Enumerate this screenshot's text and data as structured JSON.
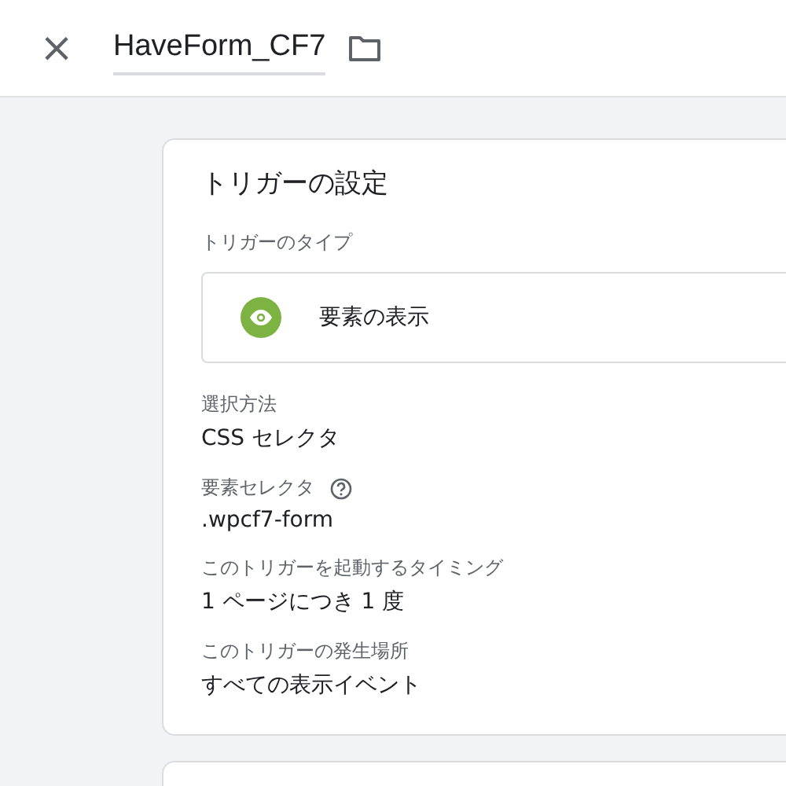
{
  "header": {
    "close": "×",
    "title": "HaveForm_CF7"
  },
  "card": {
    "title": "トリガーの設定",
    "type_label": "トリガーのタイプ",
    "type_value": "要素の表示",
    "fields": [
      {
        "kind": "plain",
        "label": "選択方法",
        "value": "CSS セレクタ"
      },
      {
        "kind": "help",
        "label": "要素セレクタ",
        "value": ".wpcf7-form"
      },
      {
        "kind": "plain",
        "label": "このトリガーを起動するタイミング",
        "value": "1 ページにつき 1 度"
      },
      {
        "kind": "plain",
        "label": "このトリガーの発生場所",
        "value": "すべての表示イベント"
      }
    ]
  }
}
